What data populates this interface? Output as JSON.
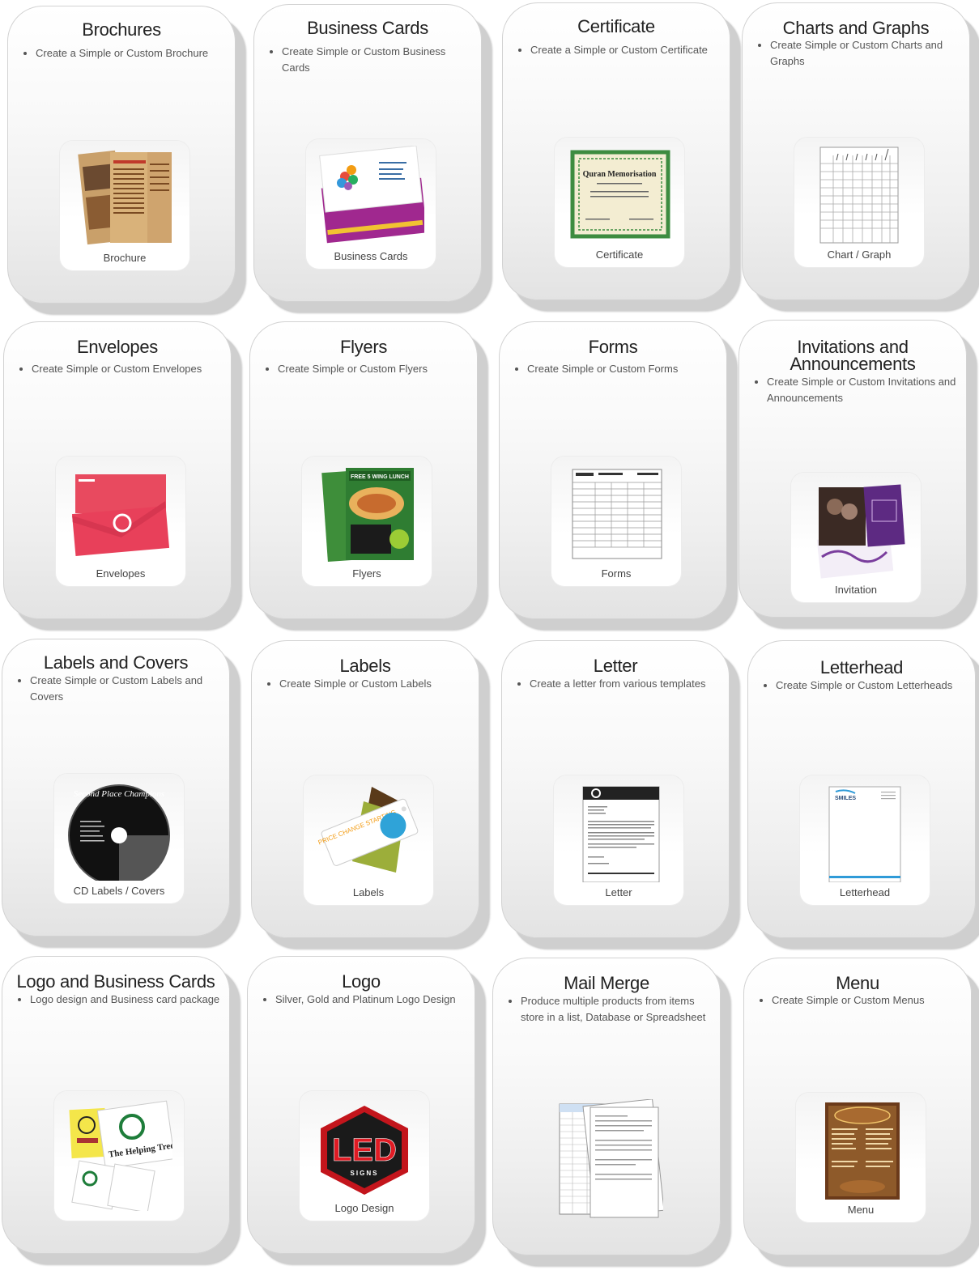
{
  "cards": [
    {
      "title": "Brochures",
      "desc": "Create a Simple or Custom Brochure",
      "caption": "Brochure",
      "icon": "brochure-icon"
    },
    {
      "title": "Business Cards",
      "desc": "Create Simple or Custom Business Cards",
      "caption": "Business Cards",
      "icon": "business-cards-icon"
    },
    {
      "title": "Certificate",
      "desc": "Create a Simple or Custom Certificate",
      "caption": "Certificate",
      "icon": "certificate-icon",
      "thumb_text": "Quran Memorisation"
    },
    {
      "title": "Charts and Graphs",
      "desc": "Create Simple or Custom Charts and Graphs",
      "caption": "Chart / Graph",
      "icon": "chart-graph-icon"
    },
    {
      "title": "Envelopes",
      "desc": "Create Simple or Custom Envelopes",
      "caption": "Envelopes",
      "icon": "envelopes-icon"
    },
    {
      "title": "Flyers",
      "desc": "Create Simple or Custom Flyers",
      "caption": "Flyers",
      "icon": "flyers-icon",
      "thumb_text": "FREE 5 WING LUNCH"
    },
    {
      "title": "Forms",
      "desc": "Create Simple or Custom Forms",
      "caption": "Forms",
      "icon": "forms-icon"
    },
    {
      "title": "Invitations and Announcements",
      "desc": "Create Simple or Custom Invitations and Announcements",
      "caption": "Invitation",
      "icon": "invitation-icon"
    },
    {
      "title": "Labels and Covers",
      "desc": "Create Simple or Custom Labels and Covers",
      "caption": "CD Labels / Covers",
      "icon": "cd-label-icon",
      "thumb_text": "Second Place Champions"
    },
    {
      "title": "Labels",
      "desc": "Create Simple or Custom Labels",
      "caption": "Labels",
      "icon": "labels-icon",
      "thumb_text": "PRICE CHANGE STARTING"
    },
    {
      "title": "Letter",
      "desc": "Create a letter from various templates",
      "caption": "Letter",
      "icon": "letter-icon"
    },
    {
      "title": "Letterhead",
      "desc": "Create Simple or Custom Letterheads",
      "caption": "Letterhead",
      "icon": "letterhead-icon",
      "thumb_text": "SMILES"
    },
    {
      "title": "Logo and Business Cards",
      "desc": "Logo design and Business card package",
      "caption": "",
      "icon": "logo-business-cards-icon",
      "thumb_text": "The Helping Tree"
    },
    {
      "title": "Logo",
      "desc": "Silver, Gold and Platinum Logo Design",
      "caption": "Logo Design",
      "icon": "logo-design-icon",
      "thumb_text": "LED",
      "thumb_sub": "SIGNS"
    },
    {
      "title": "Mail Merge",
      "desc": "Produce multiple products from items store in a list, Database or Spreadsheet",
      "caption": "",
      "icon": "mail-merge-icon"
    },
    {
      "title": "Menu",
      "desc": "Create Simple or Custom Menus",
      "caption": "Menu",
      "icon": "menu-icon"
    }
  ]
}
